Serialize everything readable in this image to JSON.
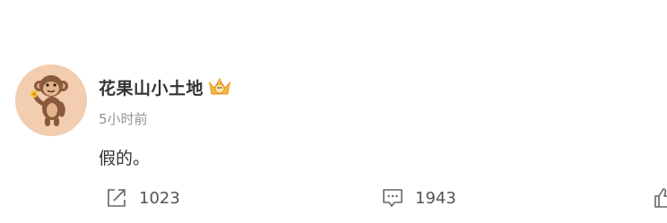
{
  "post": {
    "username": "花果山小土地",
    "timestamp": "5小时前",
    "content": "假的。",
    "badge_icon": "crown-badge-icon",
    "avatar_icon": "monkey-avatar-icon"
  },
  "actions": {
    "share": {
      "icon": "share-icon",
      "count": "1023"
    },
    "comment": {
      "icon": "comment-icon",
      "count": "1943"
    },
    "like": {
      "icon": "thumbs-up-icon"
    }
  },
  "colors": {
    "username": "#333333",
    "timestamp": "#939393",
    "icon": "#666666",
    "avatar_bg": "#f2cdb0"
  }
}
